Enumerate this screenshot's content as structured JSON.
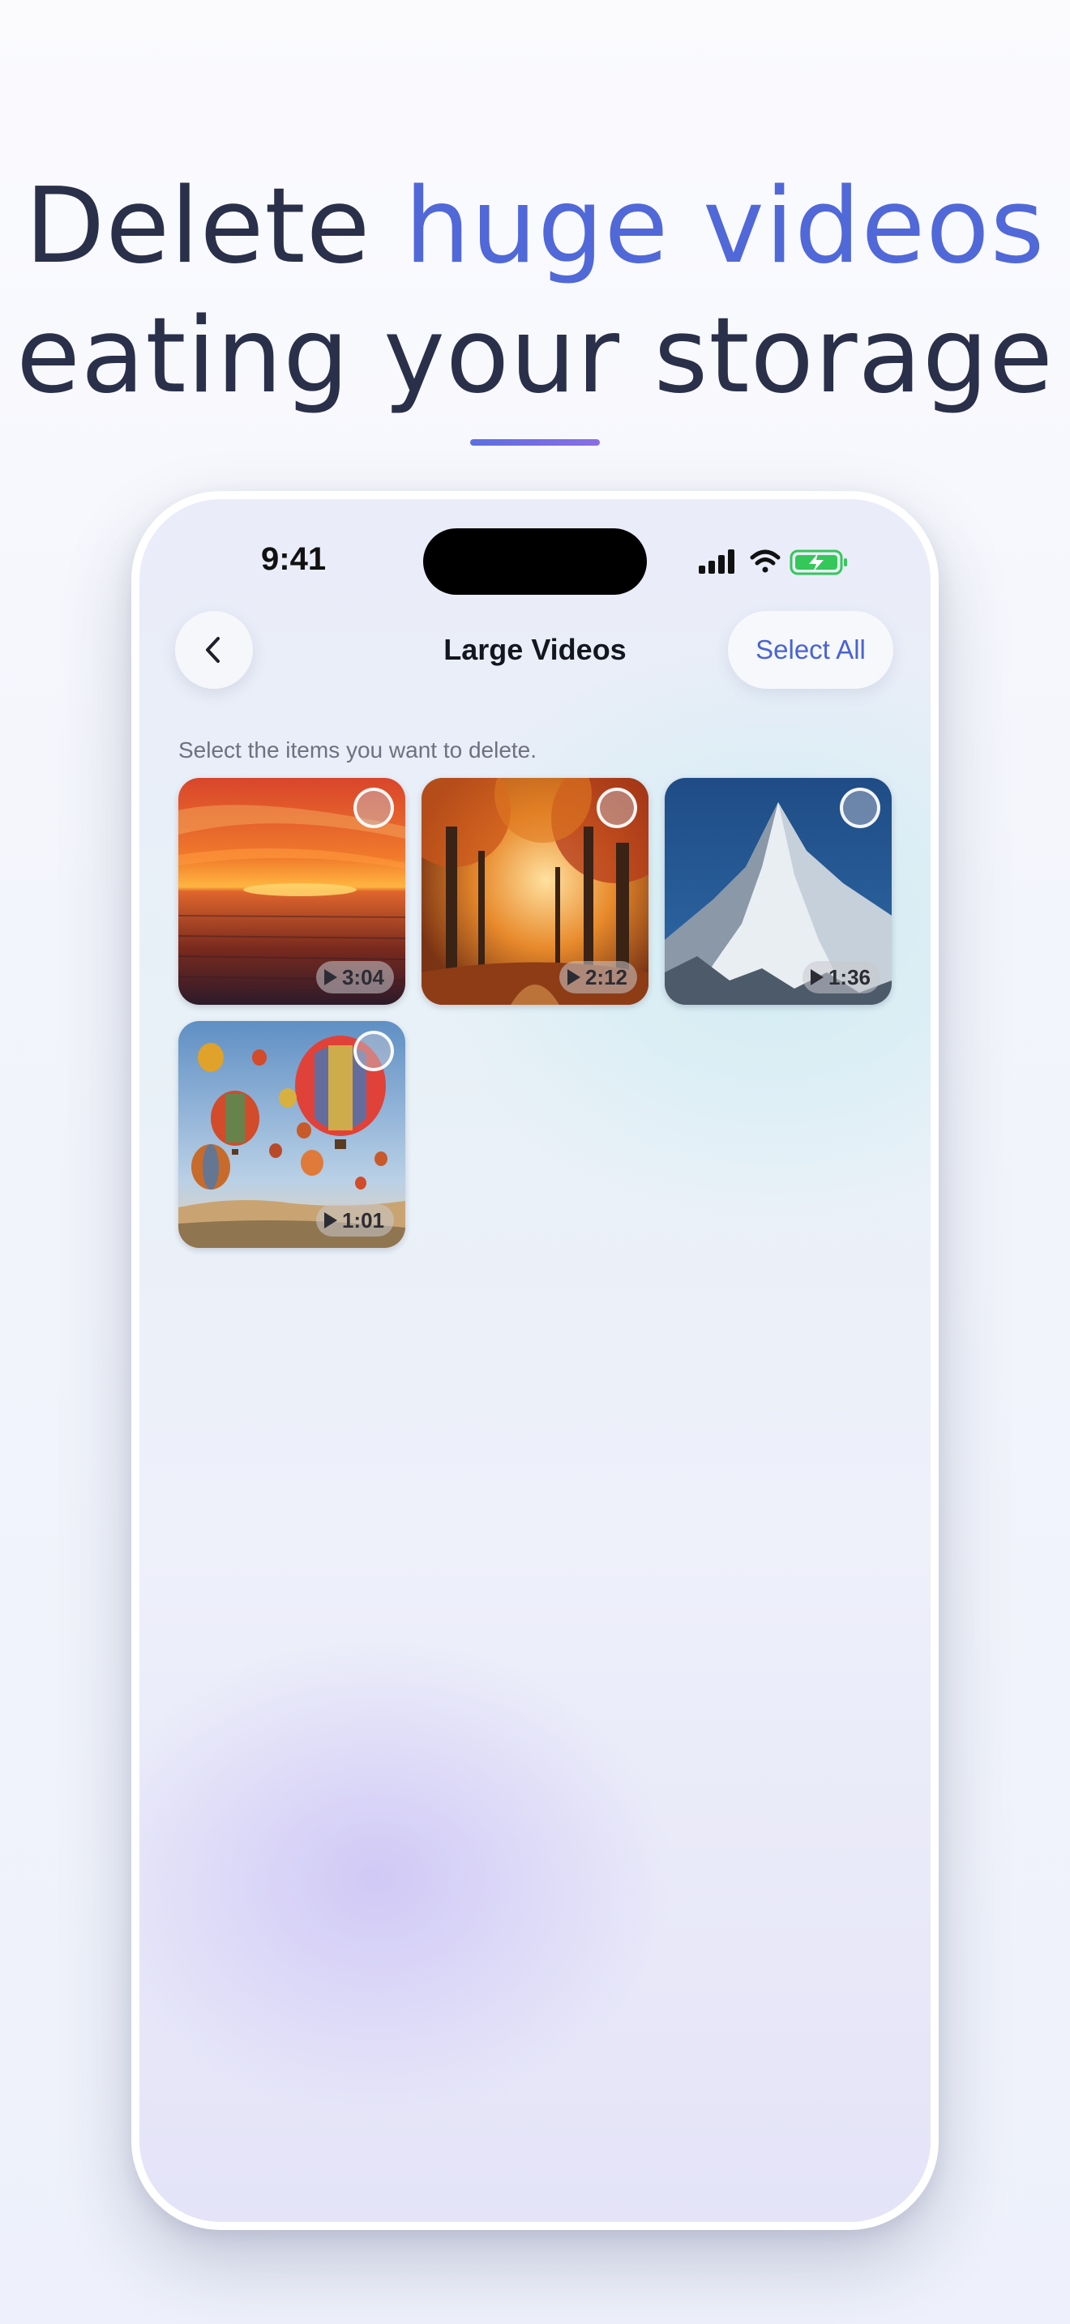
{
  "headline": {
    "line1_plain": "Delete ",
    "line1_accent": "huge videos",
    "line2": "eating your storage"
  },
  "status_bar": {
    "time": "9:41"
  },
  "nav": {
    "back_icon": "chevron-left-icon",
    "title": "Large Videos",
    "select_all_label": "Select All"
  },
  "hint": "Select the items you want to delete.",
  "videos": [
    {
      "scene": "sunset over ocean",
      "duration": "3:04",
      "selected": false
    },
    {
      "scene": "autumn forest path",
      "duration": "2:12",
      "selected": false
    },
    {
      "scene": "snowy mountain peak",
      "duration": "1:36",
      "selected": false
    },
    {
      "scene": "hot air balloons",
      "duration": "1:01",
      "selected": false
    }
  ],
  "colors": {
    "headline_text": "#2a304a",
    "accent": "#5168d8",
    "battery_green": "#34c759"
  }
}
